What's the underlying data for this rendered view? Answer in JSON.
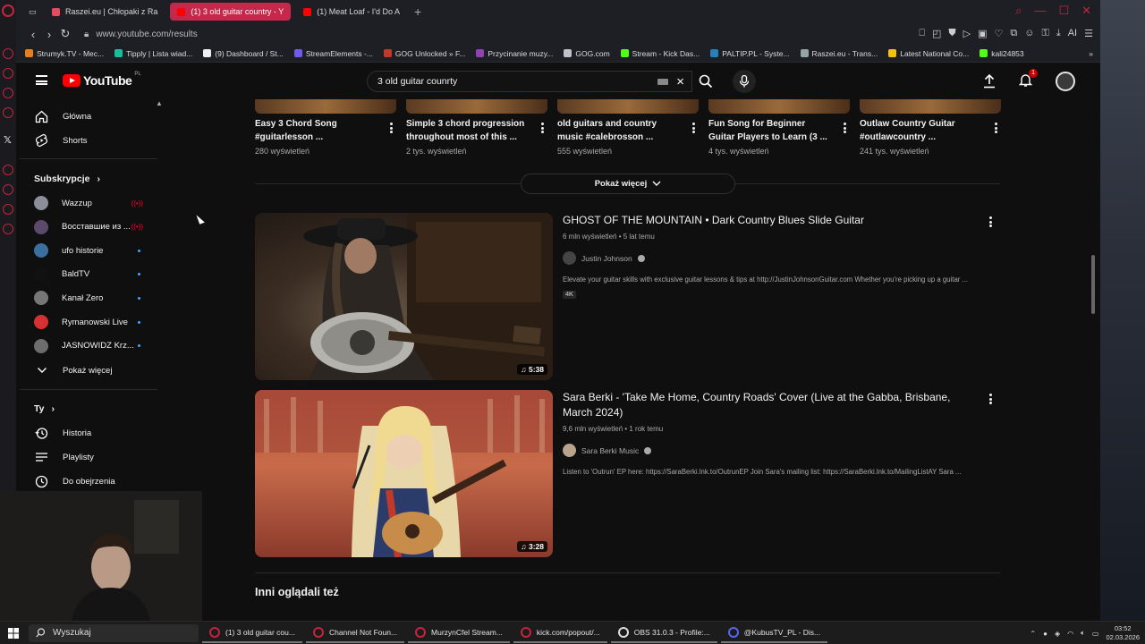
{
  "browser": {
    "tabs": [
      {
        "label": "Raszei.eu | Chłopaki z Ra",
        "fav": "#e84a5f",
        "active": false
      },
      {
        "label": "(1) 3 old guitar country - Y",
        "fav": "#ff0000",
        "active": true
      },
      {
        "label": "(1) Meat Loaf - I'd Do A",
        "fav": "#ff0000",
        "active": false
      }
    ],
    "url": "www.youtube.com/results",
    "bookmarks": [
      {
        "label": "Strumyk.TV - Mec...",
        "color": "#e67e22"
      },
      {
        "label": "Tipply | Lista wiad...",
        "color": "#1abc9c"
      },
      {
        "label": "(9) Dashboard / St...",
        "color": "#ecf0f1"
      },
      {
        "label": "StreamElements -...",
        "color": "#6c5ce7"
      },
      {
        "label": "GOG Unlocked » F...",
        "color": "#c0392b"
      },
      {
        "label": "Przycinanie muzy...",
        "color": "#8e44ad"
      },
      {
        "label": "GOG.com",
        "color": "#bdc3c7"
      },
      {
        "label": "Stream - Kick Das...",
        "color": "#53fc18"
      },
      {
        "label": "PALTIP.PL - Syste...",
        "color": "#2980b9"
      },
      {
        "label": "Raszei.eu - Trans...",
        "color": "#95a5a6"
      },
      {
        "label": "Latest National Co...",
        "color": "#f1c40f"
      },
      {
        "label": "kali24853",
        "color": "#53fc18"
      }
    ],
    "ai_label": "AI"
  },
  "yt": {
    "logo": "YouTube",
    "region": "PL",
    "search_query": "3 old guitar counrty",
    "notifications": "1",
    "sidebar": {
      "main": [
        {
          "label": "Główna",
          "icon": "home-icon"
        },
        {
          "label": "Shorts",
          "icon": "shorts-icon"
        }
      ],
      "subs_title": "Subskrypcje",
      "subs": [
        {
          "label": "Wazzup",
          "color": "#8a8f99",
          "status": "live"
        },
        {
          "label": "Восставшие из ...",
          "color": "#5b4a6b",
          "status": "live"
        },
        {
          "label": "ufo historie",
          "color": "#3b6fa0",
          "status": "dot"
        },
        {
          "label": "BaldTV",
          "color": "#111111",
          "status": "dot"
        },
        {
          "label": "Kanał Zero",
          "color": "#777777",
          "status": "dot"
        },
        {
          "label": "Rymanowski Live",
          "color": "#d63031",
          "status": "dot"
        },
        {
          "label": "JASNOWIDZ Krz...",
          "color": "#6d6d6d",
          "status": "dot"
        }
      ],
      "show_more": "Pokaż więcej",
      "you_title": "Ty",
      "you": [
        {
          "label": "Historia",
          "icon": "history-icon"
        },
        {
          "label": "Playlisty",
          "icon": "playlists-icon"
        },
        {
          "label": "Do obejrzenia",
          "icon": "watch-later-icon"
        }
      ]
    },
    "shorts": [
      {
        "title": "Easy 3 Chord Song #guitarlesson ...",
        "views": "280 wyświetleń"
      },
      {
        "title": "Simple 3 chord progression throughout most of this ...",
        "views": "2 tys. wyświetleń"
      },
      {
        "title": "old guitars and country music #calebrosson ...",
        "views": "555 wyświetleń"
      },
      {
        "title": "Fun Song for Beginner Guitar Players to Learn (3 ...",
        "views": "4 tys. wyświetleń"
      },
      {
        "title": "Outlaw Country Guitar #outlawcountry ...",
        "views": "241 tys. wyświetleń"
      }
    ],
    "show_more_btn": "Pokaż więcej",
    "videos": [
      {
        "title": "GHOST OF THE MOUNTAIN • Dark Country Blues Slide Guitar",
        "meta": "6 mln wyświetleń • 5 lat temu",
        "channel": "Justin Johnson",
        "desc": "Elevate your guitar skills with exclusive guitar lessons & tips at http://JustinJohnsonGuitar.com Whether you're picking up a guitar ...",
        "badge": "4K",
        "duration": "5:38"
      },
      {
        "title": "Sara Berki - 'Take Me Home, Country Roads' Cover (Live at the Gabba, Brisbane, March 2024)",
        "meta": "9,6 mln wyświetleń • 1 rok temu",
        "channel": "Sara Berki Music",
        "desc": "Listen to 'Outrun' EP here: https://SaraBerki.lnk.to/OutrunEP Join Sara's mailing list: https://SaraBerki.lnk.to/MailingListAY Sara ...",
        "badge": "",
        "duration": "3:28"
      }
    ],
    "section_title": "Inni oglądali też"
  },
  "taskbar": {
    "search_label": "Wyszukaj",
    "apps": [
      {
        "label": "(1) 3 old guitar cou...",
        "color": "#c4243e"
      },
      {
        "label": "Channel Not Foun...",
        "color": "#c4243e"
      },
      {
        "label": "MurzynCfel Stream...",
        "color": "#c4243e"
      },
      {
        "label": "kick.com/popout/...",
        "color": "#c4243e"
      },
      {
        "label": "OBS 31.0.3 - Profile:...",
        "color": "#dddddd"
      },
      {
        "label": "@KubusTV_PL - Dis...",
        "color": "#5865f2"
      }
    ],
    "time": "03:52",
    "date": "02.03.2026"
  }
}
